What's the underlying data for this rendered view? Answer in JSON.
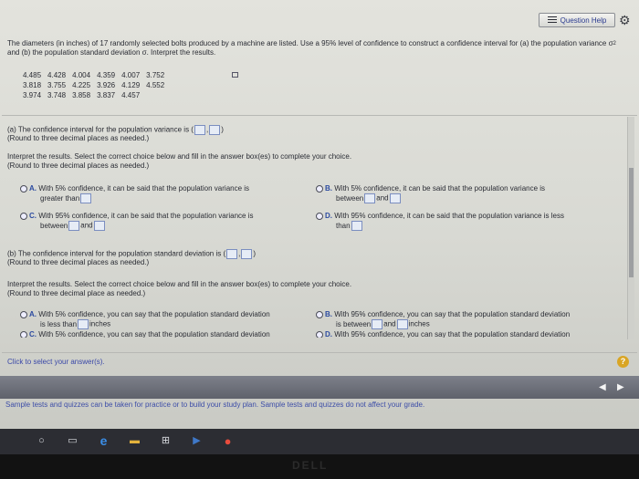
{
  "header": {
    "help_label": "Question Help"
  },
  "intro": {
    "line1": "The diameters (in inches) of 17 randomly selected bolts produced by a machine are listed. Use a 95% level of confidence to construct a confidence interval for (a) the",
    "line2_pre": "population variance σ",
    "line2_sup": "2",
    "line2_post": " and (b) the population standard deviation σ. Interpret the results."
  },
  "data_rows": [
    [
      "4.485",
      "4.428",
      "4.004",
      "4.359",
      "4.007",
      "3.752"
    ],
    [
      "3.818",
      "3.755",
      "4.225",
      "3.926",
      "4.129",
      "4.552"
    ],
    [
      "3.974",
      "3.748",
      "3.858",
      "3.837",
      "4.457",
      ""
    ]
  ],
  "part_a": {
    "prompt": "(a) The confidence interval for the population variance is (",
    "comma": ",",
    "close": ")",
    "round": "(Round to three decimal places as needed.)",
    "interpret": "Interpret the results. Select the correct choice below and fill in the answer box(es) to complete your choice.",
    "interpret_round": "(Round to three decimal places as needed.)",
    "choice_a_letter": "A.",
    "choice_a_1": "With 5% confidence, it can be said that the population variance is",
    "choice_a_2": "greater than",
    "choice_b_letter": "B.",
    "choice_b_1": "With 5% confidence, it can be said that the population variance is",
    "choice_b_2": "between",
    "choice_b_and": "and",
    "choice_c_letter": "C.",
    "choice_c_1": "With 95% confidence, it can be said that the population variance is",
    "choice_c_2": "between",
    "choice_c_and": "and",
    "choice_d_letter": "D.",
    "choice_d_1": "With 95% confidence, it can be said that the population variance is less",
    "choice_d_2": "than"
  },
  "part_b": {
    "prompt": "(b) The confidence interval for the population standard deviation is (",
    "comma": ",",
    "close": ")",
    "round": "(Round to three decimal places as needed.)",
    "interpret": "Interpret the results. Select the correct choice below and fill in the answer box(es) to complete your choice.",
    "interpret_round": "(Round to three decimal place as needed.)",
    "choice_a_letter": "A.",
    "choice_a_1": "With 5% confidence, you can say that the population standard deviation",
    "choice_a_2": "is less than",
    "choice_a_units": "inches",
    "choice_b_letter": "B.",
    "choice_b_1": "With 95% confidence, you can say that the population standard deviation",
    "choice_b_2": "is between",
    "choice_b_and": "and",
    "choice_b_units": "inches",
    "choice_c_letter": "C.",
    "choice_c_1": "With 5% confidence, you can say that the population standard deviation",
    "choice_d_letter": "D.",
    "choice_d_1": "With 95% confidence, you can say that the population standard deviation"
  },
  "footer": {
    "click_text": "Click to select your answer(s).",
    "help_mark": "?",
    "note": "Sample tests and quizzes can be taken for practice or to build your study plan. Sample tests and quizzes do not affect your grade."
  },
  "taskbar": {
    "brand": "DELL"
  },
  "colors": {
    "accent": "#2b4aa0",
    "help": "#d9a524"
  }
}
